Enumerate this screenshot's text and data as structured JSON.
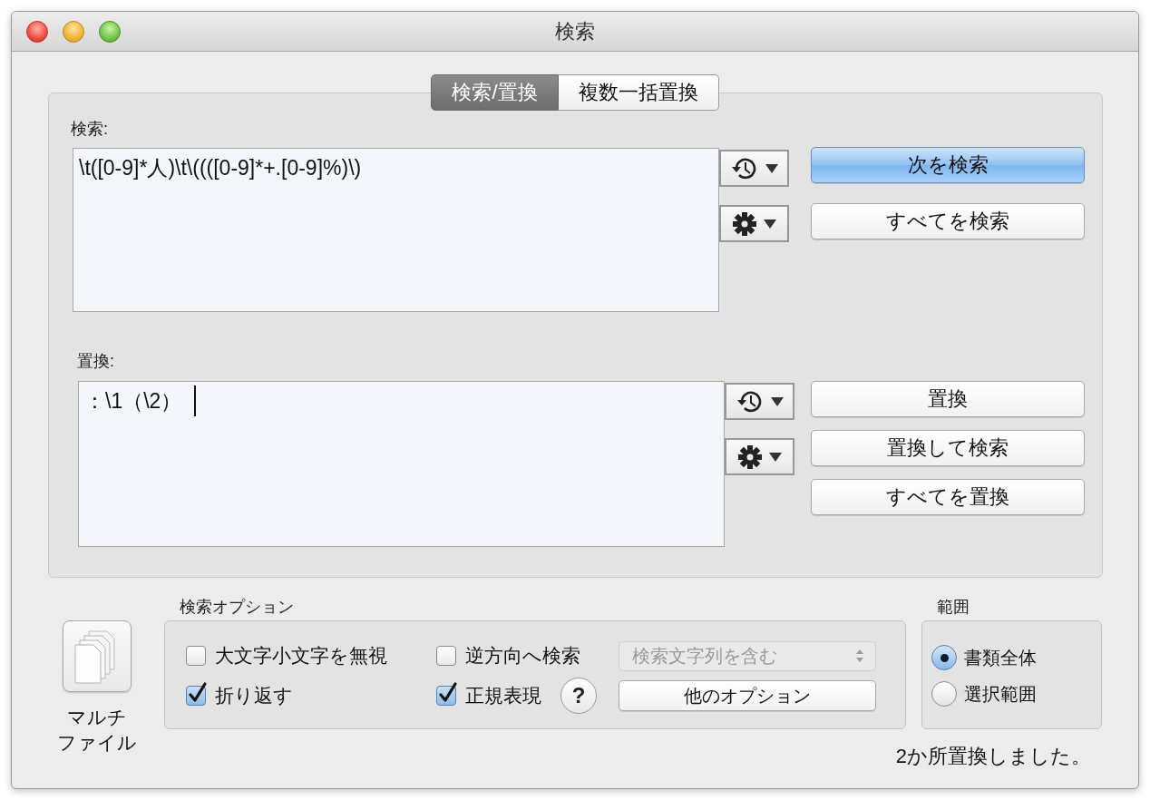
{
  "window": {
    "title": "検索"
  },
  "tabs": [
    {
      "label": "検索/置換",
      "selected": true
    },
    {
      "label": "複数一括置換",
      "selected": false
    }
  ],
  "find": {
    "label": "検索:",
    "value": "\\t([0-9]*人)\\t\\((([0-9]*+.[0-9]%)\\)",
    "buttons": [
      {
        "label": "次を検索",
        "default": true
      },
      {
        "label": "すべてを検索",
        "default": false
      }
    ]
  },
  "replace": {
    "label": "置換:",
    "value": "：\\1（\\2）",
    "buttons": [
      {
        "label": "置換",
        "default": false
      },
      {
        "label": "置換して検索",
        "default": false
      },
      {
        "label": "すべてを置換",
        "default": false
      }
    ]
  },
  "multi_file": {
    "label_lines": [
      "マルチ",
      "ファイル"
    ]
  },
  "search_options": {
    "title": "検索オプション",
    "checkboxes": [
      {
        "label": "大文字小文字を無視",
        "checked": false
      },
      {
        "label": "逆方向へ検索",
        "checked": false
      },
      {
        "label": "折り返す",
        "checked": true
      },
      {
        "label": "正規表現",
        "checked": true
      }
    ],
    "match_popup": {
      "value": "検索文字列を含む",
      "disabled": true
    },
    "help": "?",
    "more_button": "他のオプション"
  },
  "range": {
    "title": "範囲",
    "options": [
      {
        "label": "書類全体",
        "selected": true
      },
      {
        "label": "選択範囲",
        "selected": false
      }
    ]
  },
  "status": "2か所置換しました。"
}
